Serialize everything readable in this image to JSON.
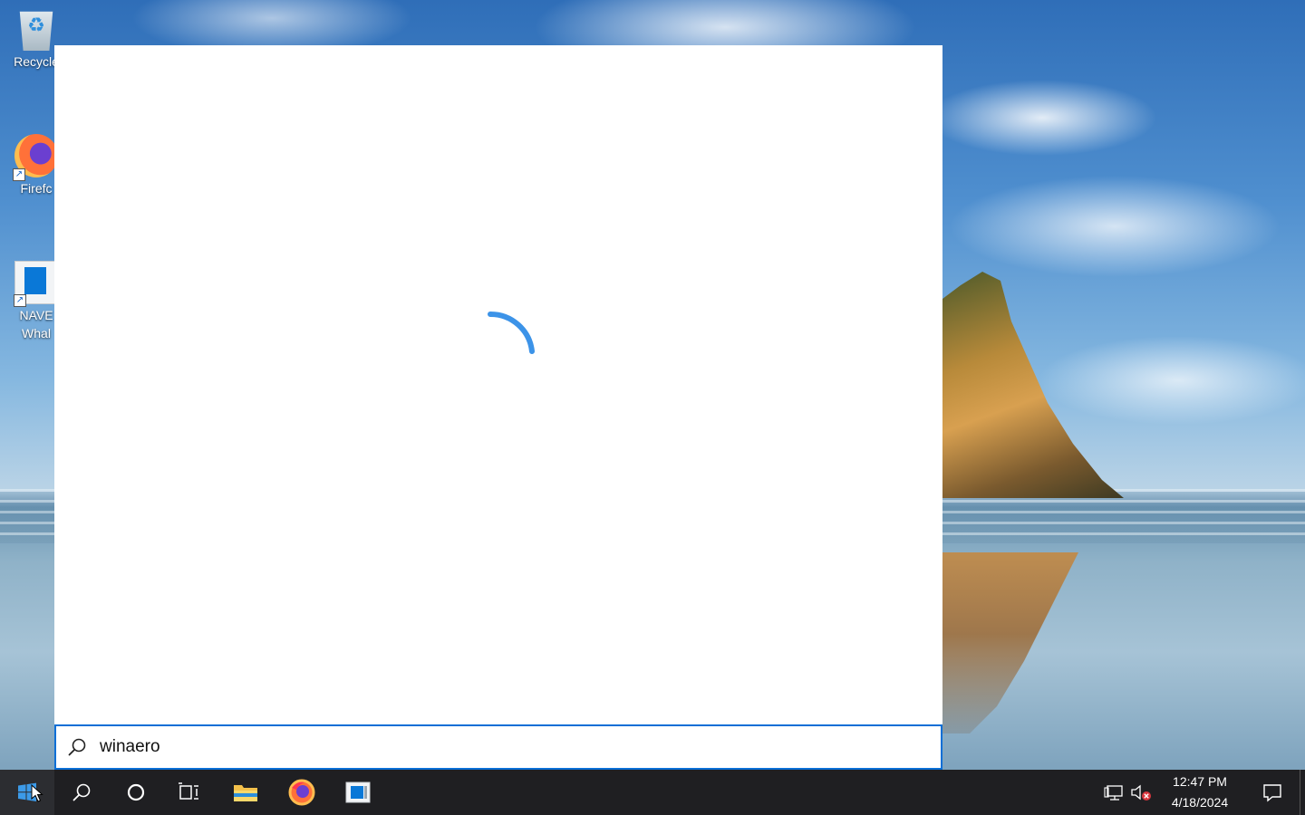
{
  "desktop": {
    "icons": [
      {
        "label": "Recycle",
        "icon": "recycle-bin-icon"
      },
      {
        "label": "Firefc",
        "icon": "firefox-icon"
      },
      {
        "label_line1": "NAVE",
        "label_line2": "Whal",
        "icon": "naver-whale-icon"
      }
    ]
  },
  "search": {
    "query": "winaero",
    "status": "loading",
    "spinner_color": "#3c93e8",
    "accent_color": "#0a6fd6"
  },
  "taskbar": {
    "buttons": [
      "start-icon",
      "search-icon",
      "cortana-icon",
      "task-view-icon"
    ],
    "pinned_apps": [
      "file-explorer-icon",
      "firefox-icon",
      "naver-whale-icon"
    ],
    "tray_icons": [
      "network-icon",
      "volume-muted-icon"
    ],
    "clock": {
      "time": "12:47 PM",
      "date": "4/18/2024"
    },
    "notification_icon": "action-center-icon"
  }
}
